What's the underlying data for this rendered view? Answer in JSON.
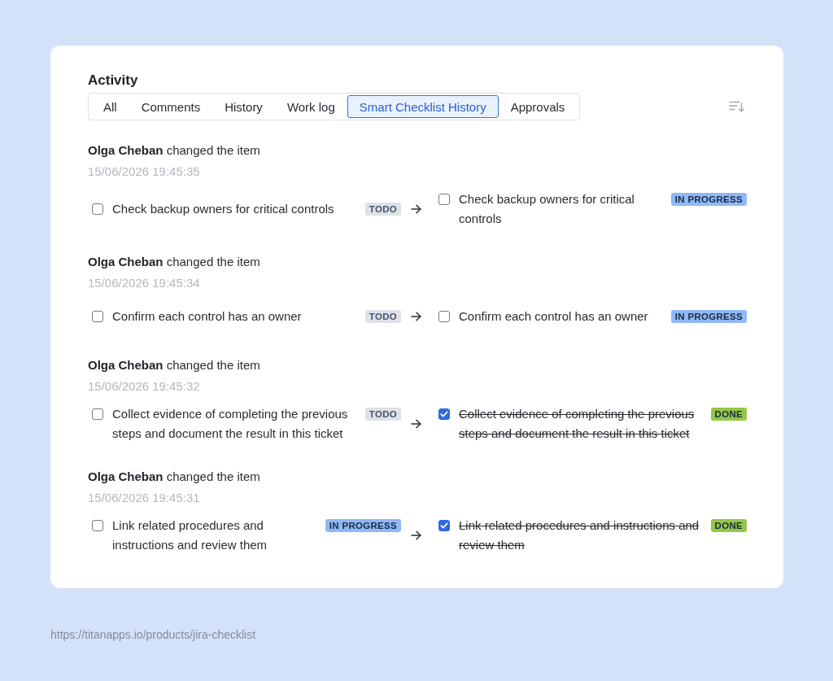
{
  "panel": {
    "title": "Activity",
    "tabs": [
      {
        "label": "All",
        "selected": false
      },
      {
        "label": "Comments",
        "selected": false
      },
      {
        "label": "History",
        "selected": false
      },
      {
        "label": "Work log",
        "selected": false
      },
      {
        "label": "Smart Checklist History",
        "selected": true
      },
      {
        "label": "Approvals",
        "selected": false
      }
    ],
    "entries": [
      {
        "summary": "**Olga Cheban** changed the item",
        "timestamp": "15/06/2026 19:45:35",
        "before": {
          "text": "Check backup owners for critical controls",
          "checked": false,
          "badge": {
            "label": "TODO",
            "kind": "todo"
          }
        },
        "after": {
          "text": "Check backup owners for critical controls",
          "checked": false,
          "badge": {
            "label": "IN PROGRESS",
            "kind": "in_progress"
          }
        }
      },
      {
        "summary": "**Olga Cheban** changed the item",
        "timestamp": "15/06/2026 19:45:34",
        "before": {
          "text": "Confirm each control has an owner",
          "checked": false,
          "badge": {
            "label": "TODO",
            "kind": "todo"
          }
        },
        "after": {
          "text": "Confirm each control has an owner",
          "checked": false,
          "badge": {
            "label": "IN PROGRESS",
            "kind": "in_progress"
          }
        }
      },
      {
        "summary": "**Olga Cheban** changed the item",
        "timestamp": "15/06/2026 19:45:32",
        "before": {
          "text": "Collect evidence of completing the previous steps and document the result in this ticket",
          "checked": false,
          "badge": {
            "label": "TODO",
            "kind": "todo"
          }
        },
        "after": {
          "text": "Collect evidence of completing the previous steps and document the result in this ticket",
          "checked": true,
          "badge": {
            "label": "DONE",
            "kind": "done"
          }
        }
      },
      {
        "summary": "**Olga Cheban** changed the item",
        "timestamp": "15/06/2026 19:45:31",
        "before": {
          "text": "Link related procedures and instructions and review them",
          "checked": false,
          "badge": {
            "label": "IN PROGRESS",
            "kind": "in_progress"
          }
        },
        "after": {
          "text": "Link related procedures and instructions and review them",
          "checked": true,
          "badge": {
            "label": "DONE",
            "kind": "done"
          }
        }
      }
    ]
  },
  "footer_url": "https://titanapps.io/products/jira-checklist"
}
